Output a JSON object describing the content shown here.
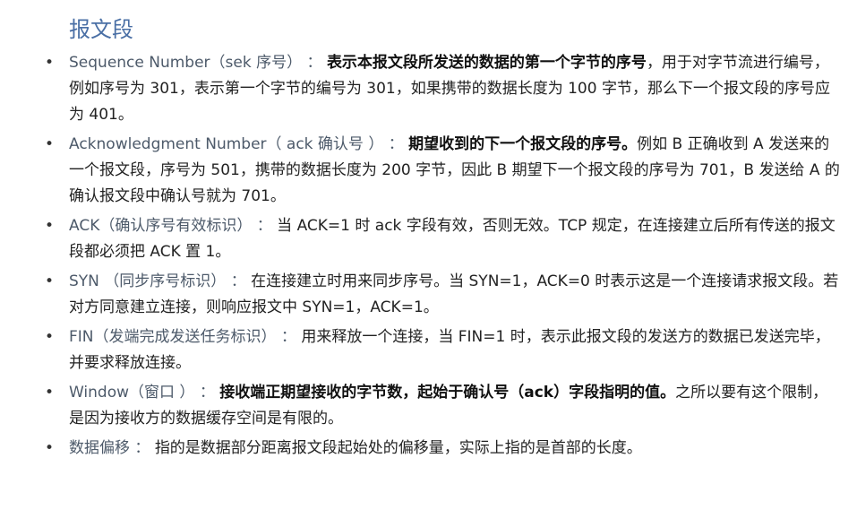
{
  "heading": "报文段",
  "items": [
    {
      "term": "Sequence Number（sek 序号）",
      "sep": "：",
      "strong": "表示本报文段所发送的数据的第一个字节的序号",
      "desc": "，用于对字节流进行编号，例如序号为 301，表示第一个字节的编号为 301，如果携带的数据长度为 100 字节，那么下一个报文段的序号应为 401。"
    },
    {
      "term": "Acknowledgment Number（ ack 确认号 ）",
      "sep": "：",
      "strong": "期望收到的下一个报文段的序号。",
      "desc": "例如 B 正确收到 A 发送来的一个报文段，序号为 501，携带的数据长度为 200 字节，因此 B 期望下一个报文段的序号为 701，B 发送给 A 的确认报文段中确认号就为 701。"
    },
    {
      "term": " ACK（确认序号有效标识）",
      "sep": "：",
      "strong": "",
      "desc": "当 ACK=1 时 ack 字段有效，否则无效。TCP 规定，在连接建立后所有传送的报文段都必须把 ACK 置 1。"
    },
    {
      "term": "SYN （同步序号标识）",
      "sep": "：",
      "strong": "",
      "desc": "在连接建立时用来同步序号。当 SYN=1，ACK=0 时表示这是一个连接请求报文段。若对方同意建立连接，则响应报文中 SYN=1，ACK=1。"
    },
    {
      "term": "FIN（发端完成发送任务标识）",
      "sep": "：",
      "strong": "",
      "desc": "用来释放一个连接，当 FIN=1 时，表示此报文段的发送方的数据已发送完毕，并要求释放连接。"
    },
    {
      "term": "Window（窗口 ）",
      "sep": "：",
      "strong": "接收端正期望接收的字节数，起始于确认号（ack）字段指明的值。",
      "desc": "之所以要有这个限制，是因为接收方的数据缓存空间是有限的。"
    },
    {
      "term": "数据偏移",
      "sep": "：",
      "strong": "",
      "desc": "指的是数据部分距离报文段起始处的偏移量，实际上指的是首部的长度。"
    }
  ]
}
